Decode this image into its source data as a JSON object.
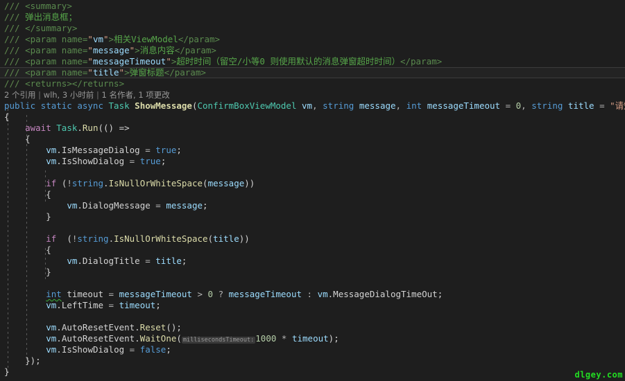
{
  "editor": {
    "theme": "dark",
    "background": "#1e1e1e",
    "language": "C#",
    "current_line_number": 8
  },
  "colors": {
    "comment": "#57A64A",
    "doc_tag": "#608B4E",
    "keyword": "#569CD6",
    "control_keyword": "#C586C0",
    "type": "#4EC9B0",
    "method": "#DCDCAA",
    "variable": "#9CDCFE",
    "string": "#D69D85",
    "number": "#B5CEA8",
    "plain": "#D4D4D4",
    "codelens": "#999999",
    "squiggle": "#3BB23B",
    "watermark": "#22DD22"
  },
  "codelens": {
    "references": "2 个引用",
    "author_change": "wlh, 3 小时前",
    "changes": "1 名作者, 1 项更改",
    "separator": "|"
  },
  "doc_comment": {
    "summary_open": "<summary>",
    "summary_text": "弹出消息框；",
    "summary_close": "</summary>",
    "params": [
      {
        "name": "vm",
        "desc": "相关ViewModel"
      },
      {
        "name": "message",
        "desc": "消息内容"
      },
      {
        "name": "messageTimeout",
        "desc": "超时时间（留空/小等0 则使用默认的消息弹窗超时时间）"
      },
      {
        "name": "title",
        "desc": "弹窗标题"
      }
    ],
    "returns": "<returns></returns>"
  },
  "signature": {
    "modifiers": "public static async",
    "return_type": "Task",
    "method_name": "ShowMessage",
    "parameters": [
      {
        "type": "ConfirmBoxViewModel",
        "name": "vm"
      },
      {
        "type": "string",
        "name": "message"
      },
      {
        "type": "int",
        "name": "messageTimeout",
        "default": "0"
      },
      {
        "type": "string",
        "name": "title",
        "default": "\"请知悉\""
      }
    ]
  },
  "code": {
    "await_task_run": "await Task.Run(() =>",
    "set_is_message_dialog": "vm.IsMessageDialog = true;",
    "set_is_show_dialog_true": "vm.IsShowDialog = true;",
    "if_message": "if (!string.IsNullOrWhiteSpace(message))",
    "assign_dialog_message": "vm.DialogMessage = message;",
    "if_title": "if (!string.IsNullOrWhiteSpace(title))",
    "assign_dialog_title": "vm.DialogTitle = title;",
    "timeout_decl": "int timeout = messageTimeout > 0 ? messageTimeout : vm.MessageDialogTimeOut;",
    "assign_left_time": "vm.LeftTime = timeout;",
    "reset_event": "vm.AutoResetEvent.Reset();",
    "wait_one": "vm.AutoResetEvent.WaitOne(1000 * timeout);",
    "inline_hint": "millisecondsTimeout:",
    "wait_one_value": "1000",
    "set_is_show_dialog_false": "vm.IsShowDialog = false;",
    "close_lambda": "});",
    "close_method": "}",
    "open_brace": "{",
    "close_brace": "}"
  },
  "watermark": {
    "text": "dlgey.com"
  }
}
